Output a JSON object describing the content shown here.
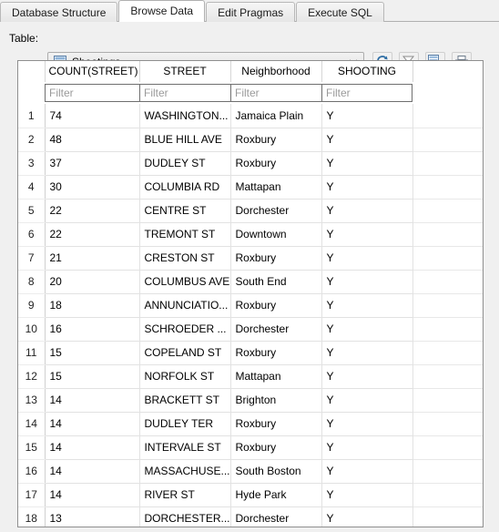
{
  "tabs": [
    {
      "label": "Database Structure",
      "selected": false
    },
    {
      "label": "Browse Data",
      "selected": true
    },
    {
      "label": "Edit Pragmas",
      "selected": false
    },
    {
      "label": "Execute SQL",
      "selected": false
    }
  ],
  "toolbar": {
    "table_label": "Table:",
    "table_value": "Shootings",
    "table_icon": "table-icon",
    "dropdown_arrow": "∨",
    "buttons": [
      {
        "name": "refresh-button",
        "icon": "refresh-icon"
      },
      {
        "name": "clear-filters-button",
        "icon": "filter-clear-icon"
      },
      {
        "name": "save-results-button",
        "icon": "save-icon"
      },
      {
        "name": "print-button",
        "icon": "print-icon"
      }
    ]
  },
  "grid": {
    "row_header": "",
    "columns": [
      "COUNT(STREET)",
      "STREET",
      "Neighborhood",
      "SHOOTING"
    ],
    "filter_placeholder": "Filter",
    "filters": [
      "Filter",
      "Filter",
      "Filter",
      "Filter"
    ],
    "rows": [
      {
        "n": "1",
        "count": "74",
        "street": "WASHINGTON...",
        "neighborhood": "Jamaica Plain",
        "shooting": "Y"
      },
      {
        "n": "2",
        "count": "48",
        "street": "BLUE HILL AVE",
        "neighborhood": "Roxbury",
        "shooting": "Y"
      },
      {
        "n": "3",
        "count": "37",
        "street": "DUDLEY ST",
        "neighborhood": "Roxbury",
        "shooting": "Y"
      },
      {
        "n": "4",
        "count": "30",
        "street": "COLUMBIA RD",
        "neighborhood": "Mattapan",
        "shooting": "Y"
      },
      {
        "n": "5",
        "count": "22",
        "street": "CENTRE ST",
        "neighborhood": "Dorchester",
        "shooting": "Y"
      },
      {
        "n": "6",
        "count": "22",
        "street": "TREMONT ST",
        "neighborhood": "Downtown",
        "shooting": "Y"
      },
      {
        "n": "7",
        "count": "21",
        "street": "CRESTON ST",
        "neighborhood": "Roxbury",
        "shooting": "Y"
      },
      {
        "n": "8",
        "count": "20",
        "street": "COLUMBUS AVE",
        "neighborhood": "South End",
        "shooting": "Y"
      },
      {
        "n": "9",
        "count": "18",
        "street": "ANNUNCIATIO...",
        "neighborhood": "Roxbury",
        "shooting": "Y"
      },
      {
        "n": "10",
        "count": "16",
        "street": "SCHROEDER ...",
        "neighborhood": "Dorchester",
        "shooting": "Y"
      },
      {
        "n": "11",
        "count": "15",
        "street": "COPELAND ST",
        "neighborhood": "Roxbury",
        "shooting": "Y"
      },
      {
        "n": "12",
        "count": "15",
        "street": "NORFOLK ST",
        "neighborhood": "Mattapan",
        "shooting": "Y"
      },
      {
        "n": "13",
        "count": "14",
        "street": "BRACKETT ST",
        "neighborhood": "Brighton",
        "shooting": "Y"
      },
      {
        "n": "14",
        "count": "14",
        "street": "DUDLEY TER",
        "neighborhood": "Roxbury",
        "shooting": "Y"
      },
      {
        "n": "15",
        "count": "14",
        "street": "INTERVALE ST",
        "neighborhood": "Roxbury",
        "shooting": "Y"
      },
      {
        "n": "16",
        "count": "14",
        "street": "MASSACHUSE...",
        "neighborhood": "South Boston",
        "shooting": "Y"
      },
      {
        "n": "17",
        "count": "14",
        "street": "RIVER ST",
        "neighborhood": "Hyde Park",
        "shooting": "Y"
      },
      {
        "n": "18",
        "count": "13",
        "street": "DORCHESTER...",
        "neighborhood": "Dorchester",
        "shooting": "Y"
      }
    ]
  },
  "colors": {
    "window_bg": "#f0f0f0",
    "grid_bg": "#ffffff",
    "grid_border": "#8f8f8f",
    "cell_border": "#e2e2e2",
    "filter_text": "#9a9a9a",
    "tab_selected_bg": "#ffffff"
  }
}
